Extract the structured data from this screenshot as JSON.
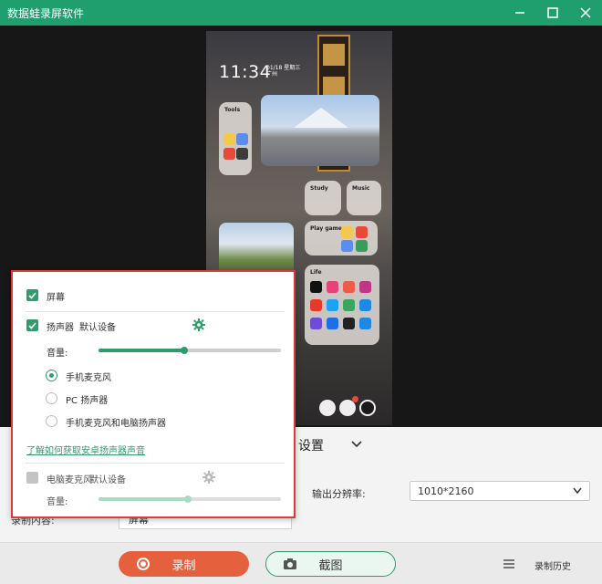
{
  "app": {
    "title": "数据蛙录屏软件"
  },
  "window_controls": {
    "minimize_icon": "minimize-icon",
    "maximize_icon": "maximize-icon",
    "close_icon": "close-icon"
  },
  "phone_preview": {
    "time": "11:34",
    "date_lines": [
      "01/18 星期三",
      "广州"
    ],
    "widgets": {
      "tools": "Tools",
      "study": "Study",
      "music": "Music",
      "play_games": "Play games",
      "life": "Life"
    }
  },
  "audio_popup": {
    "screen": {
      "label": "屏幕",
      "checked": true
    },
    "speaker": {
      "label": "扬声器",
      "device": "默认设备",
      "checked": true,
      "volume_label": "音量:",
      "volume_level": 0.47
    },
    "mic_options": [
      {
        "label": "手机麦克风",
        "selected": true
      },
      {
        "label": "PC 扬声器",
        "selected": false
      },
      {
        "label": "手机麦克风和电脑扬声器",
        "selected": false
      }
    ],
    "help_link": "了解如何获取安卓扬声器声音",
    "pc_mic": {
      "label": "电脑麦克风",
      "device": "默认设备",
      "checked": false,
      "volume_label": "音量:",
      "volume_level": 0.49
    }
  },
  "settings": {
    "tab_label": "设置",
    "resolution_label": "输出分辨率:",
    "resolution_value": "1010*2160",
    "record_content_label": "录制内容:",
    "record_content_value": "屏幕"
  },
  "bottom_bar": {
    "record_label": "录制",
    "screenshot_label": "截图",
    "history_label": "录制历史"
  },
  "colors": {
    "brand": "#1f9e6e",
    "record": "#e5613e",
    "accent": "#2f9c6b",
    "highlight_border": "#d93a3a"
  }
}
